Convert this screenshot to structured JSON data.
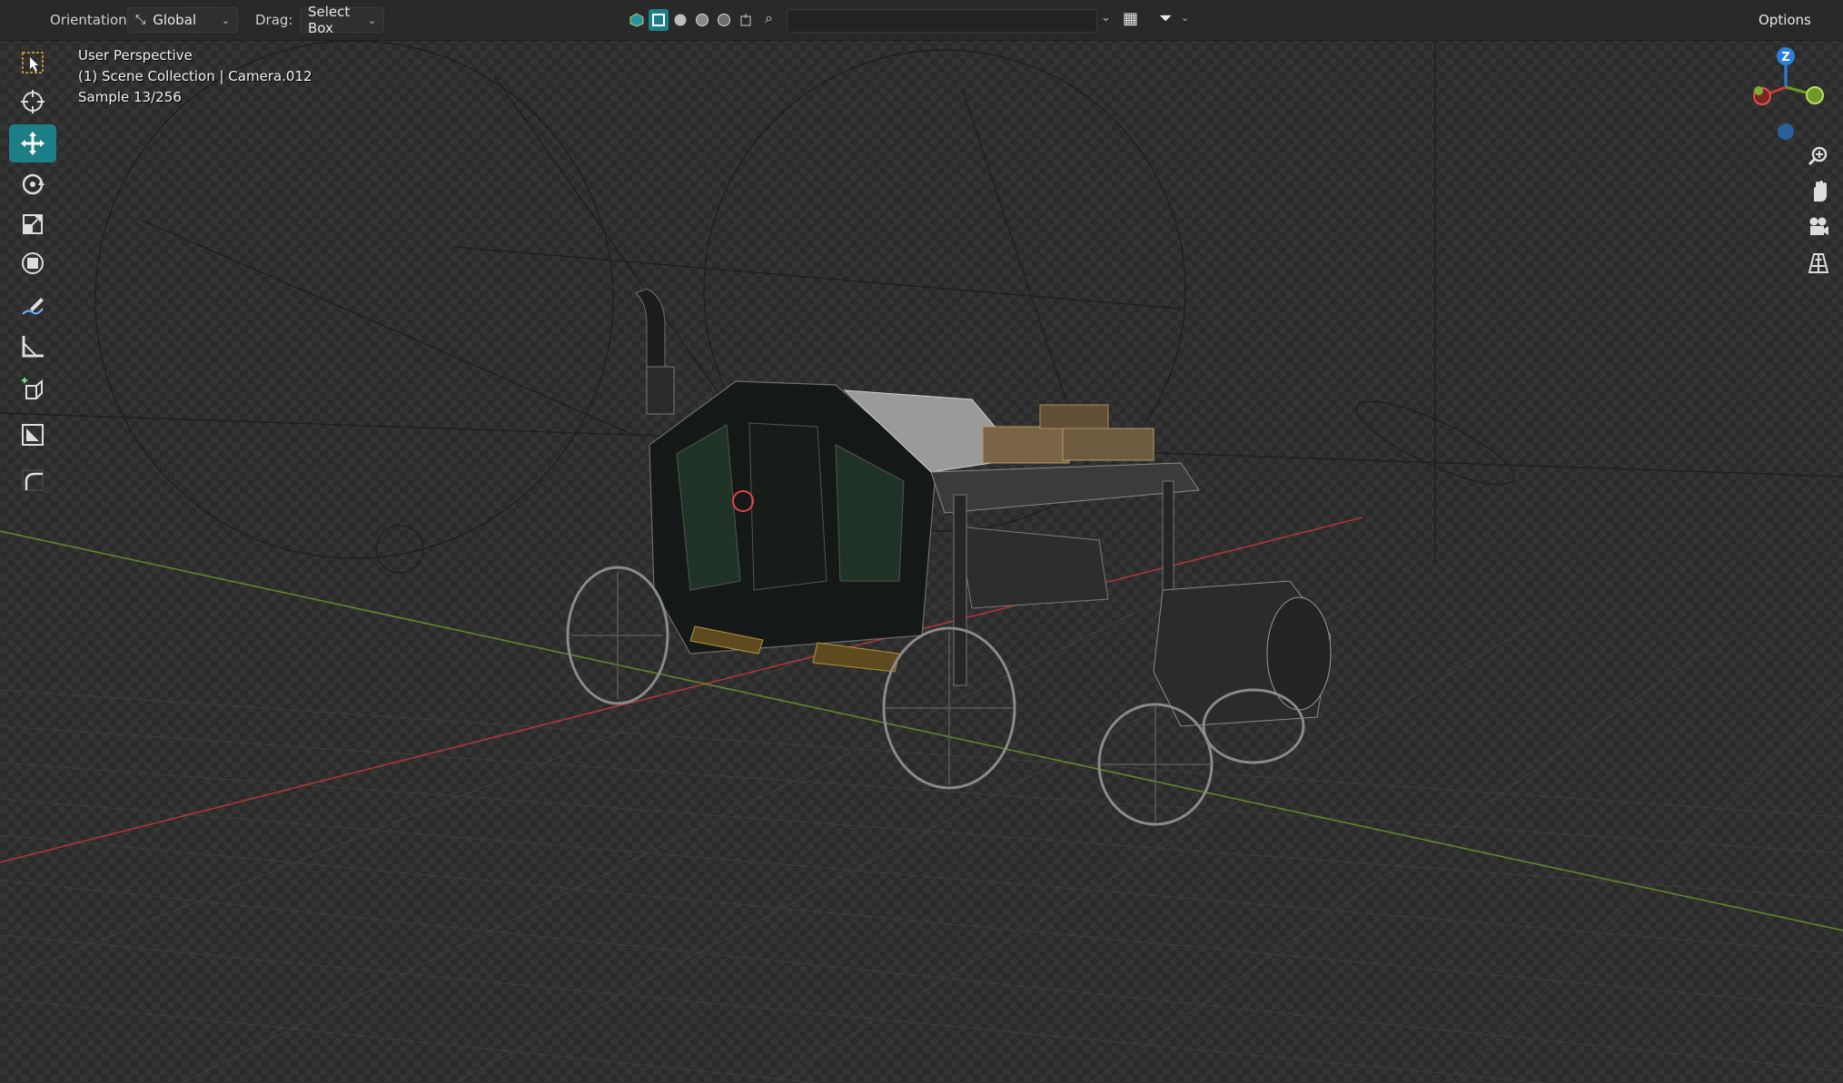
{
  "header": {
    "orientation_label": "Orientation:",
    "orientation_value": "Global",
    "drag_label": "Drag:",
    "drag_value": "Select Box",
    "search_placeholder": "",
    "options_label": "Options"
  },
  "toolbar": {
    "tools": [
      {
        "name": "select-box-tool",
        "icon": "select-box-icon"
      },
      {
        "name": "cursor-tool",
        "icon": "cursor-icon"
      },
      {
        "name": "move-tool",
        "icon": "move-icon",
        "active": true
      },
      {
        "name": "rotate-tool",
        "icon": "rotate-icon"
      },
      {
        "name": "scale-tool",
        "icon": "scale-icon"
      },
      {
        "name": "transform-tool",
        "icon": "transform-icon"
      },
      {
        "name": "annotate-tool",
        "icon": "annotate-icon"
      },
      {
        "name": "measure-tool",
        "icon": "measure-icon"
      },
      {
        "name": "add-cube-tool",
        "icon": "add-cube-icon"
      },
      {
        "name": "shade-tool",
        "icon": "shade-icon"
      },
      {
        "name": "smooth-tool",
        "icon": "smooth-icon"
      }
    ]
  },
  "viewport": {
    "view_name": "User Perspective",
    "collection_info": "(1) Scene Collection | Camera.012",
    "sample_info": "Sample 13/256"
  },
  "gizmo": {
    "z_label": "Z"
  },
  "colors": {
    "accent": "#1d7f86",
    "x_axis": "#c8393c",
    "y_axis": "#6f9a2a",
    "z_axis": "#2c7fd8",
    "background": "#2b2b2b"
  }
}
